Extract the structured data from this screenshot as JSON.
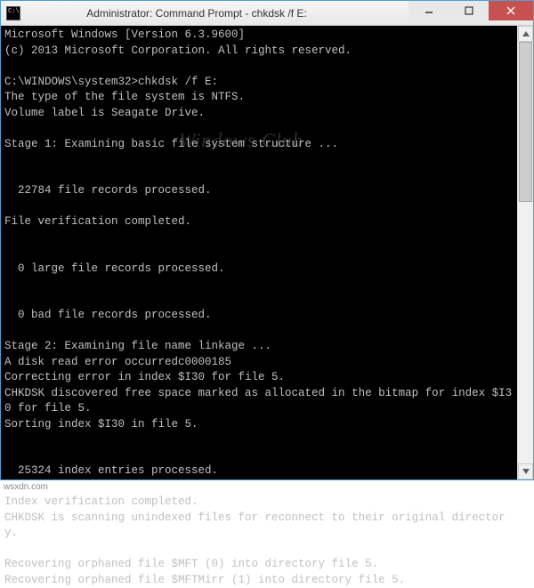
{
  "titlebar": {
    "title": "Administrator: Command Prompt - chkdsk  /f E:"
  },
  "terminal": {
    "lines": "Microsoft Windows [Version 6.3.9600]\n(c) 2013 Microsoft Corporation. All rights reserved.\n\nC:\\WINDOWS\\system32>chkdsk /f E:\nThe type of the file system is NTFS.\nVolume label is Seagate Drive.\n\nStage 1: Examining basic file system structure ...\n\n\n  22784 file records processed.\n\nFile verification completed.\n\n\n  0 large file records processed.\n\n\n  0 bad file records processed.\n\nStage 2: Examining file name linkage ...\nA disk read error occurredc0000185\nCorrecting error in index $I30 for file 5.\nCHKDSK discovered free space marked as allocated in the bitmap for index $I30 for file 5.\nSorting index $I30 in file 5.\n\n\n  25324 index entries processed.\n\nIndex verification completed.\nCHKDSK is scanning unindexed files for reconnect to their original directory.\n\nRecovering orphaned file $MFT (0) into directory file 5.\nRecovering orphaned file $MFTMirr (1) into directory file 5."
  },
  "watermark": "Windows Club",
  "footer": "wsxdn.com"
}
